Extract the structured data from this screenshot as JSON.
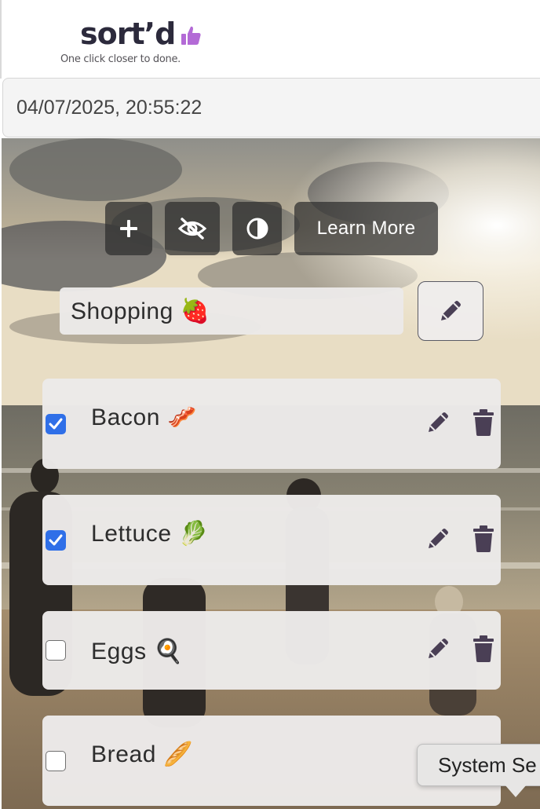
{
  "app": {
    "logo_text": "sort’d",
    "tagline": "One click closer to done."
  },
  "datetime": "04/07/2025, 20:55:22",
  "toolbar": {
    "add_icon": "plus-icon",
    "hide_icon": "eye-slash-icon",
    "theme_icon": "contrast-icon",
    "learn_more_label": "Learn More"
  },
  "list": {
    "title": "Shopping 🍓",
    "edit_icon": "pencil-icon"
  },
  "items": [
    {
      "label": "Bacon 🥓",
      "checked": true
    },
    {
      "label": "Lettuce 🥬",
      "checked": true
    },
    {
      "label": "Eggs 🍳",
      "checked": false
    },
    {
      "label": "Bread 🥖",
      "checked": false
    }
  ],
  "tooltip": {
    "text": "System Se"
  },
  "colors": {
    "checkbox_checked": "#2f6fe8",
    "icon_dark": "#4a3f55",
    "logo_accent": "#b36ad6",
    "toolbar_bg": "#2d2d2d"
  }
}
